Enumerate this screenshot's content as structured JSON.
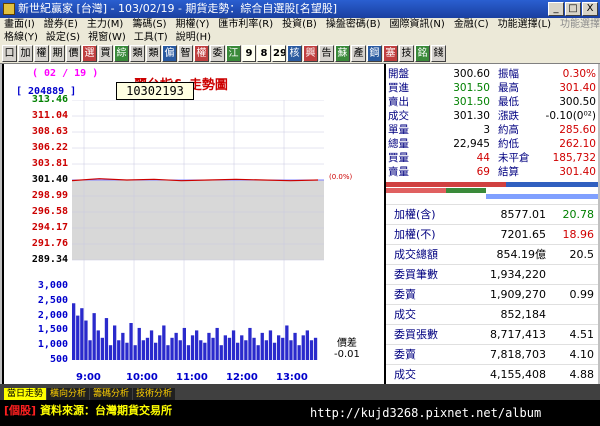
{
  "window": {
    "title": "新世紀贏家 [台灣] - 103/02/19 - 期貨走勢：綜合自選股[名望股]",
    "buttons": [
      "_",
      "□",
      "X"
    ]
  },
  "menu": {
    "row1": [
      "畫面(I)",
      "證券(E)",
      "主力(M)",
      "籌碼(S)",
      "期權(Y)",
      "匯市利率(R)",
      "投資(B)",
      "操盤密碼(B)",
      "國際資訊(N)",
      "金融(C)",
      "功能選擇(L)",
      "功能選擇(P)"
    ],
    "row1_dim": [
      "功能選擇(P)"
    ],
    "row2": [
      "格線(Y)",
      "設定(S)",
      "視窗(W)",
      "工具(T)",
      "說明(H)"
    ]
  },
  "toolbar": {
    "buttons": [
      "口",
      "加",
      "權",
      "期",
      "價",
      "選",
      "買",
      "綜",
      "類",
      "類",
      "偏",
      "智",
      "權",
      "委",
      "江",
      "9",
      "8",
      "29",
      "核",
      "興",
      "告",
      "蘇",
      "產",
      "鋼",
      "塞",
      "技",
      "銘",
      "錢"
    ],
    "num_indices": [
      15,
      16,
      17
    ]
  },
  "chart": {
    "date": "( 02 / 19 )",
    "code": "[ 204889 ]",
    "title": "麗台指& 走勢圖",
    "tooltip": "10302193",
    "zero_pct": "(0.0%)",
    "price_diff_label": "價差",
    "price_diff_value": "-0.01",
    "y_price_labels": [
      "313.46",
      "311.04",
      "308.63",
      "306.22",
      "303.81",
      "301.40",
      "298.99",
      "296.58",
      "294.17",
      "291.76",
      "289.34"
    ],
    "y_volume_labels": [
      "3,000",
      "2,500",
      "2,000",
      "1,500",
      "1,000",
      "500"
    ],
    "x_labels": [
      "9:00",
      "10:00",
      "11:00",
      "12:00",
      "13:00"
    ]
  },
  "chart_data": {
    "type": "line",
    "x": [
      "9:00",
      "10:00",
      "11:00",
      "12:00",
      "13:00"
    ],
    "ylim": [
      289.34,
      313.46
    ],
    "reference": 301.4,
    "series": [
      {
        "values": [
          301.3,
          301.6,
          301.4,
          301.5,
          301.3,
          301.4,
          301.5,
          301.4,
          301.3,
          301.4
        ]
      }
    ],
    "volume_ylim": [
      0,
      3000
    ],
    "volume": [
      2300,
      1800,
      2100,
      1600,
      800,
      1900,
      1200,
      900,
      1700,
      600,
      1400,
      800,
      1100,
      700,
      1500,
      600,
      1300,
      800,
      900,
      1200,
      700,
      1000,
      1400,
      600,
      900,
      1100,
      800,
      1300,
      600,
      1000,
      1200,
      800,
      700,
      1100,
      900,
      1300,
      600,
      1000,
      900,
      1200,
      700,
      1000,
      800,
      1300,
      900,
      600,
      1100,
      800,
      1200,
      700,
      1000,
      900,
      1400,
      800,
      1100,
      600,
      1000,
      1200,
      800,
      900
    ]
  },
  "quote": {
    "rows": [
      {
        "l1": "開盤",
        "v1": "300.60",
        "l2": "振幅",
        "v2": "0.30%",
        "v1c": "blk",
        "v2c": "red"
      },
      {
        "l1": "買進",
        "v1": "301.50",
        "l2": "最高",
        "v2": "301.40",
        "v1c": "grn",
        "v2c": "red"
      },
      {
        "l1": "賣出",
        "v1": "301.50",
        "l2": "最低",
        "v2": "300.50",
        "v1c": "grn",
        "v2c": "blk"
      },
      {
        "l1": "成交",
        "v1": "301.30",
        "l2": "漲跌",
        "v2": "-0.10(0⁰²)",
        "v1c": "blk",
        "v2c": "blk"
      },
      {
        "l1": "單量",
        "v1": "3",
        "l2": "約高",
        "v2": "285.60",
        "v1c": "blk",
        "v2c": "red"
      },
      {
        "l1": "總量",
        "v1": "22,945",
        "l2": "約低",
        "v2": "262.10",
        "v1c": "blk",
        "v2c": "red"
      },
      {
        "l1": "買量",
        "v1": "44",
        "l2": "未平倉",
        "v2": "185,732",
        "v1c": "red",
        "v2c": "red"
      },
      {
        "l1": "賣量",
        "v1": "69",
        "l2": "結算",
        "v2": "301.40",
        "v1c": "red",
        "v2c": "red"
      }
    ],
    "rows2": [
      {
        "l": "加權(含)",
        "v": "8577.01",
        "x": "20.78",
        "xc": "grn"
      },
      {
        "l": "加權(不)",
        "v": "7201.65",
        "x": "18.96",
        "xc": "red"
      },
      {
        "l": "成交總額",
        "v": "854.19億",
        "x": "20.5",
        "xc": "blk"
      },
      {
        "l": "委買筆數",
        "v": "1,934,220",
        "x": "",
        "xc": "blk"
      },
      {
        "l": "委賣",
        "v": "1,909,270",
        "x": "0.99",
        "xc": "blk"
      },
      {
        "l": "成交",
        "v": "852,184",
        "x": "",
        "xc": "blk"
      },
      {
        "l": "委買張數",
        "v": "8,717,413",
        "x": "4.51",
        "xc": "blk"
      },
      {
        "l": "委賣",
        "v": "7,818,703",
        "x": "4.10",
        "xc": "blk"
      },
      {
        "l": "成交",
        "v": "4,155,408",
        "x": "4.88",
        "xc": "blk"
      }
    ]
  },
  "tabs": [
    "當日走勢",
    "橫向分析",
    "籌碼分析",
    "技術分析"
  ],
  "status": {
    "bracket": "[個股]",
    "text": "資料來源：台灣期貨交易所",
    "watermark": "http://kujd3268.pixnet.net/album"
  }
}
